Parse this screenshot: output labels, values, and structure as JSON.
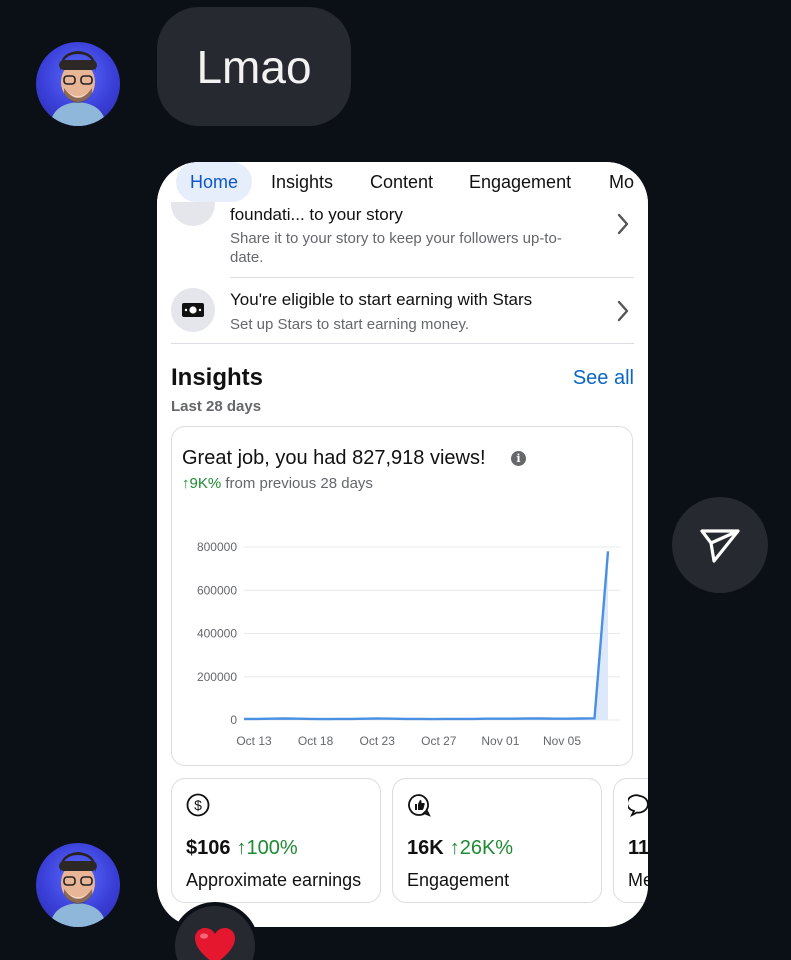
{
  "message": {
    "text": "Lmao",
    "reaction": "❤️"
  },
  "tabs": [
    "Home",
    "Insights",
    "Content",
    "Engagement",
    "Mo"
  ],
  "notifications": [
    {
      "title": "foundati...  to your story",
      "subtitle": "Share it to your story to keep your followers up-to-date."
    },
    {
      "title": "You're eligible to start earning with Stars",
      "subtitle": "Set up Stars to start earning money."
    }
  ],
  "insights": {
    "title": "Insights",
    "period": "Last 28 days",
    "see_all": "See all",
    "views_title": "Great job, you had 827,918 views!",
    "trend_value": "↑9K%",
    "trend_text": " from previous 28 days"
  },
  "chart_data": {
    "type": "area",
    "x_ticks": [
      "Oct 13",
      "Oct 18",
      "Oct 23",
      "Oct 27",
      "Nov 01",
      "Nov 05"
    ],
    "y_ticks": [
      "800000",
      "600000",
      "400000",
      "200000",
      "0"
    ],
    "ylim": [
      0,
      800000
    ],
    "series": [
      {
        "values": [
          5000,
          5000,
          6000,
          7000,
          6000,
          5000,
          4000,
          5000,
          5000,
          6000,
          7000,
          6000,
          5000,
          5000,
          4000,
          5000,
          5000,
          5000,
          6000,
          6000,
          6000,
          7000,
          7000,
          6000,
          6000,
          7000,
          8000,
          780000
        ]
      }
    ],
    "grid": true,
    "color": "#4a90e2"
  },
  "stats": [
    {
      "value": "$106",
      "change": "↑100%",
      "label": "Approximate earnings",
      "icon": "dollar-circle-icon"
    },
    {
      "value": "16K",
      "change": "↑26K%",
      "label": "Engagement",
      "icon": "thumbs-up-bubble-icon"
    },
    {
      "value": "11",
      "change": "",
      "label": "Me",
      "icon": "comment-icon"
    }
  ],
  "colors": {
    "accent": "#0a66c2",
    "positive": "#1e8a33",
    "tab_active_bg": "#e7eefb",
    "app_bg": "#0b0f16"
  }
}
